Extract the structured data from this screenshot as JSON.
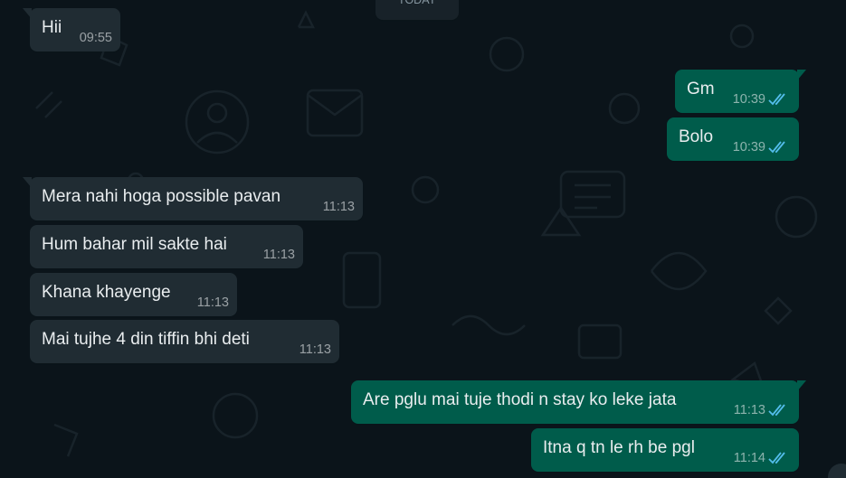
{
  "date_divider": "TODAY",
  "colors": {
    "background": "#0b141a",
    "incoming_bubble": "#202c33",
    "outgoing_bubble": "#005c4b",
    "read_ticks": "#53bdeb"
  },
  "messages": [
    {
      "direction": "in",
      "text": "Hii",
      "time": "09:55"
    },
    {
      "direction": "out",
      "text": "Gm",
      "time": "10:39",
      "status": "read-double-tick-icon"
    },
    {
      "direction": "out",
      "text": "Bolo",
      "time": "10:39",
      "status": "read-double-tick-icon"
    },
    {
      "direction": "in",
      "text": "Mera nahi hoga possible pavan",
      "time": "11:13"
    },
    {
      "direction": "in",
      "text": "Hum bahar mil sakte hai",
      "time": "11:13"
    },
    {
      "direction": "in",
      "text": "Khana khayenge",
      "time": "11:13"
    },
    {
      "direction": "in",
      "text": "Mai tujhe 4 din tiffin bhi deti",
      "time": "11:13"
    },
    {
      "direction": "out",
      "text": "Are pglu mai tuje thodi n stay ko leke jata",
      "time": "11:13",
      "status": "read-double-tick-icon"
    },
    {
      "direction": "out",
      "text": "Itna q tn le rh be pgl",
      "time": "11:14",
      "status": "read-double-tick-icon"
    }
  ]
}
